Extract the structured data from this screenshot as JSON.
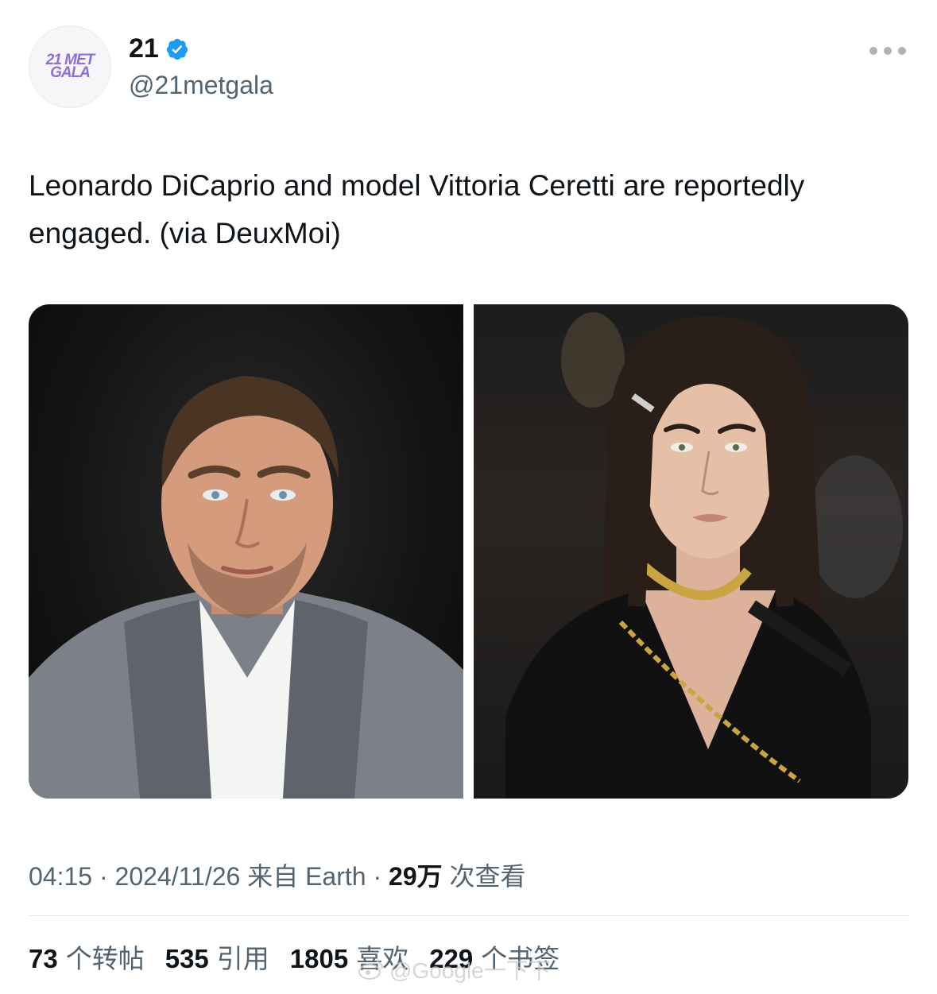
{
  "header": {
    "avatar_text_line1": "21 MET",
    "avatar_text_line2": "GALA",
    "display_name": "21",
    "handle": "@21metgala"
  },
  "tweet": {
    "text": "Leonardo DiCaprio and model Vittoria Ceretti are reportedly engaged. (via DeuxMoi)"
  },
  "meta": {
    "time": "04:15",
    "date": "2024/11/26",
    "source": "来自 Earth",
    "views_count": "29万",
    "views_label": "次查看"
  },
  "stats": [
    {
      "num": "73",
      "label": "个转帖"
    },
    {
      "num": "535",
      "label": "引用"
    },
    {
      "num": "1805",
      "label": "喜欢"
    },
    {
      "num": "229",
      "label": "个书签"
    }
  ],
  "watermark": "@Google一下下",
  "colors": {
    "verified": "#1d9bf0",
    "secondary_text": "#536471",
    "primary_text": "#0f1419",
    "avatar_accent": "#8e6fd8"
  },
  "icons": [
    "verified-badge-icon",
    "more-options-icon",
    "weibo-watermark-icon"
  ]
}
